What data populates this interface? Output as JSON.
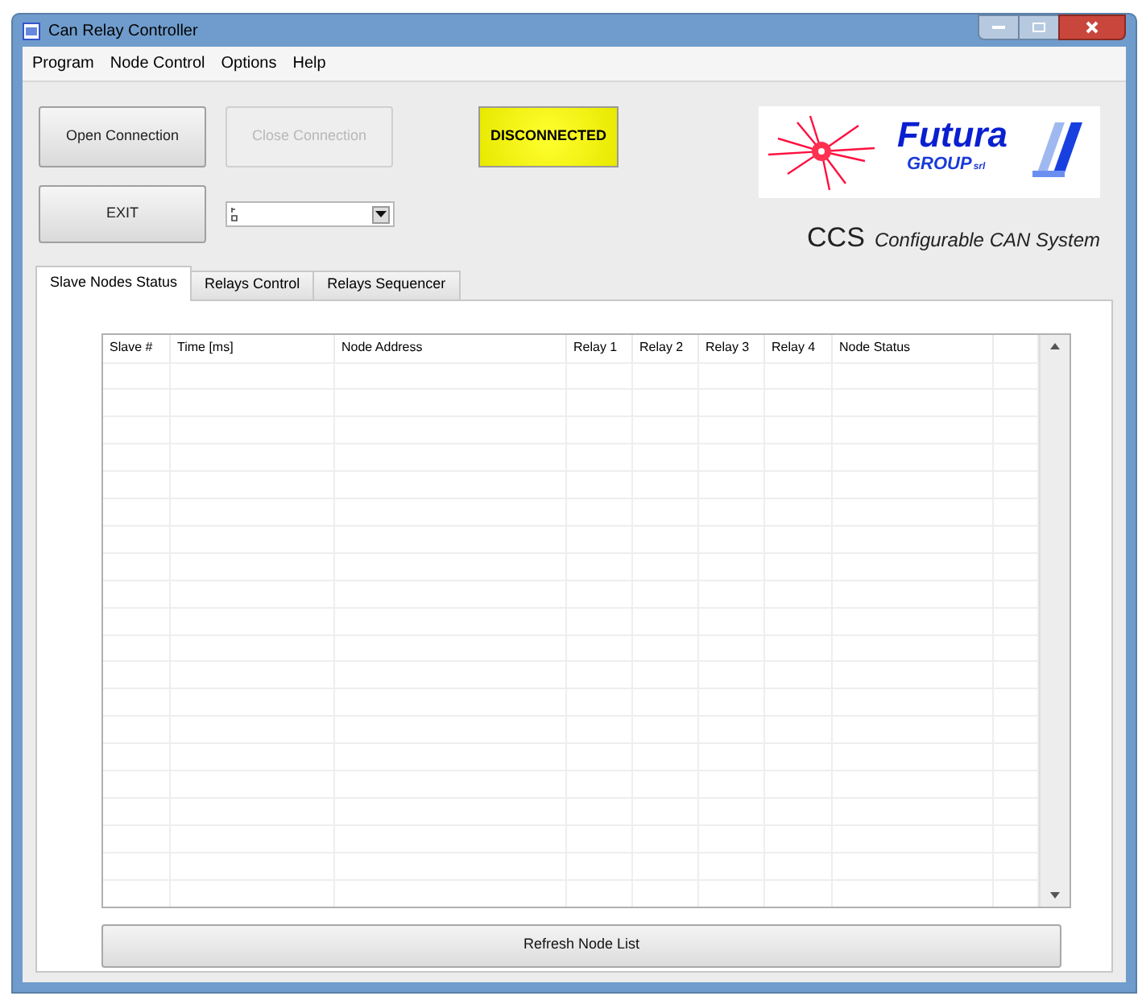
{
  "window": {
    "title": "Can Relay Controller"
  },
  "menu": [
    "Program",
    "Node Control",
    "Options",
    "Help"
  ],
  "buttons": [
    {
      "label": "Open Connection",
      "disabled": false
    },
    {
      "label": "Close Connection",
      "disabled": true
    },
    {
      "label": "EXIT",
      "disabled": false
    }
  ],
  "status_indicator": {
    "label": "DISCONNECTED",
    "lit": true
  },
  "logo": {
    "name": "Futura",
    "group": "GROUP",
    "suffix": "srl"
  },
  "subtitle": {
    "acronym": "CCS",
    "text": "Configurable CAN System"
  },
  "tabs": [
    {
      "label": "Slave Nodes Status",
      "selected": true
    },
    {
      "label": "Relays Control",
      "selected": false
    },
    {
      "label": "Relays Sequencer",
      "selected": false
    }
  ],
  "table": {
    "columns": [
      "Slave #",
      "Time [ms]",
      "Node Address",
      "Relay 1",
      "Relay 2",
      "Relay 3",
      "Relay 4",
      "Node Status"
    ]
  },
  "refresh_button": {
    "label": "Refresh Node List"
  }
}
